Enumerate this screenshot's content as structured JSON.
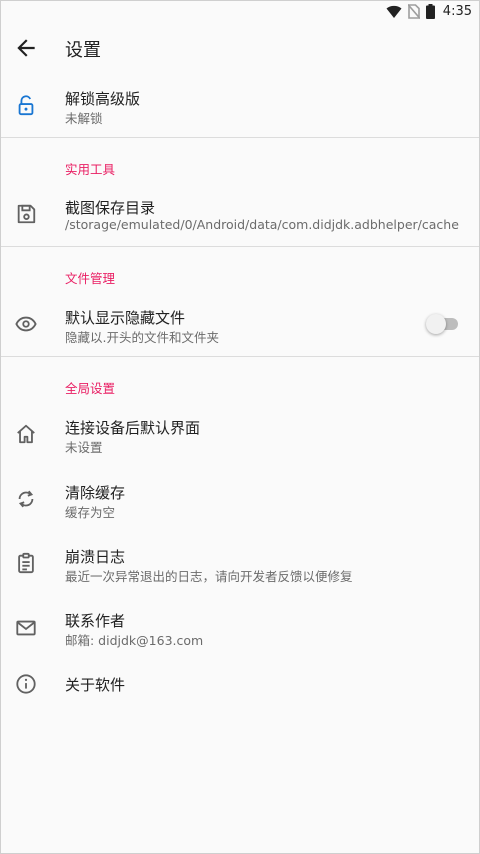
{
  "status": {
    "time": "4:35"
  },
  "appbar": {
    "title": "设置",
    "back_icon": "arrow-back-icon"
  },
  "unlock": {
    "title": "解锁高级版",
    "subtitle": "未解锁",
    "icon": "lock-open-icon",
    "icon_color": "#1976d2"
  },
  "sections": {
    "tools": "实用工具",
    "files": "文件管理",
    "global": "全局设置"
  },
  "screenshot_dir": {
    "title": "截图保存目录",
    "subtitle": "/storage/emulated/0/Android/data/com.didjdk.adbhelper/cache",
    "icon": "save-icon"
  },
  "hidden_files": {
    "title": "默认显示隐藏文件",
    "subtitle": "隐藏以.开头的文件和文件夹",
    "icon": "eye-icon",
    "enabled": false
  },
  "default_screen": {
    "title": "连接设备后默认界面",
    "subtitle": "未设置",
    "icon": "home-icon"
  },
  "clear_cache": {
    "title": "清除缓存",
    "subtitle": "缓存为空",
    "icon": "sync-icon"
  },
  "crash_log": {
    "title": "崩溃日志",
    "subtitle": "最近一次异常退出的日志，请向开发者反馈以便修复",
    "icon": "clipboard-icon"
  },
  "contact": {
    "title": "联系作者",
    "subtitle": "邮箱: didjdk@163.com",
    "icon": "mail-icon"
  },
  "about": {
    "title": "关于软件",
    "icon": "info-icon"
  },
  "colors": {
    "accent": "#e91e63",
    "primary_icon": "#1976d2",
    "icon_gray": "#616161"
  }
}
